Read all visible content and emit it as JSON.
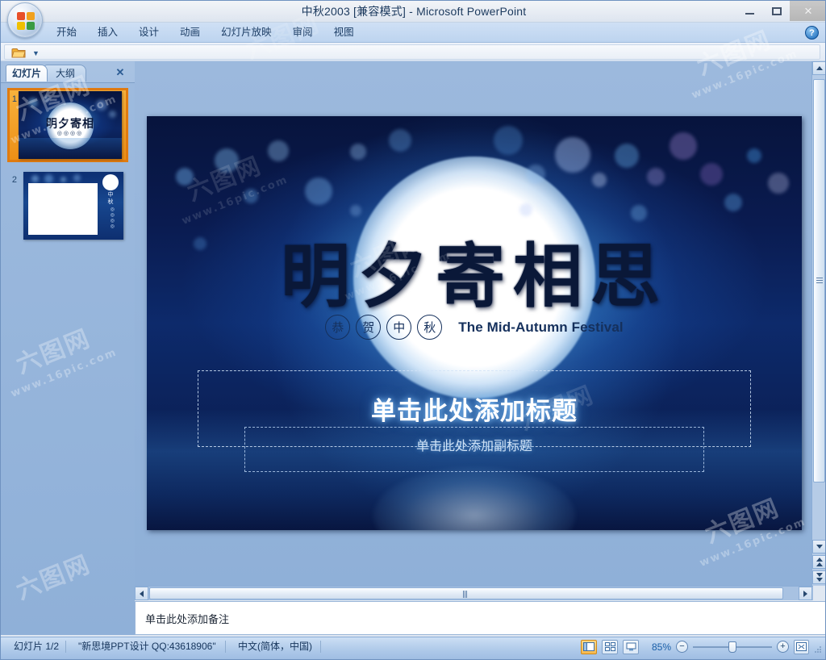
{
  "window": {
    "title": "中秋2003 [兼容模式] - Microsoft PowerPoint",
    "minimize_label": "最小化",
    "maximize_label": "最大化",
    "close_label": "×"
  },
  "ribbon": {
    "tabs": [
      {
        "label": "开始"
      },
      {
        "label": "插入"
      },
      {
        "label": "设计"
      },
      {
        "label": "动画"
      },
      {
        "label": "幻灯片放映"
      },
      {
        "label": "审阅"
      },
      {
        "label": "视图"
      }
    ],
    "help_label": "?"
  },
  "quick_toolbar": {
    "open_label": "打开",
    "dropdown_label": "▼"
  },
  "left_pane": {
    "tabs": [
      {
        "label": "幻灯片"
      },
      {
        "label": "大纲"
      }
    ],
    "close_label": "✕",
    "thumbnails": [
      {
        "number": "1",
        "selected": true
      },
      {
        "number": "2",
        "selected": false
      }
    ]
  },
  "slide": {
    "calligraphy": "明夕寄相思",
    "seals": [
      "恭",
      "贺",
      "中",
      "秋"
    ],
    "english_title": "The Mid-Autumn Festival",
    "title_placeholder": "单击此处添加标题",
    "subtitle_placeholder": "单击此处添加副标题"
  },
  "notes": {
    "placeholder": "单击此处添加备注"
  },
  "status": {
    "slide_counter": "幻灯片 1/2",
    "theme_name": "\"新思境PPT设计  QQ:43618906\"",
    "language": "中文(简体，中国)",
    "zoom_level": "85%",
    "zoom_out_label": "−",
    "zoom_in_label": "+",
    "fit_label": "适应窗口",
    "view_normal_label": "普通视图",
    "view_sorter_label": "幻灯片浏览",
    "view_show_label": "幻灯片放映"
  },
  "scroll": {
    "up_label": "向上",
    "down_label": "向下",
    "prev_slide_label": "上一张幻灯片",
    "next_slide_label": "下一张幻灯片",
    "left_label": "向左",
    "right_label": "向右"
  },
  "watermarks": {
    "primary": "六图网",
    "secondary": "www.16pic.com"
  },
  "colors": {
    "accent_orange": "#e07b10",
    "slide_dark": "#06123a",
    "title_bar": "#e6ebf3",
    "status_text": "#16355c",
    "zoom_text": "#1a5fa8"
  }
}
